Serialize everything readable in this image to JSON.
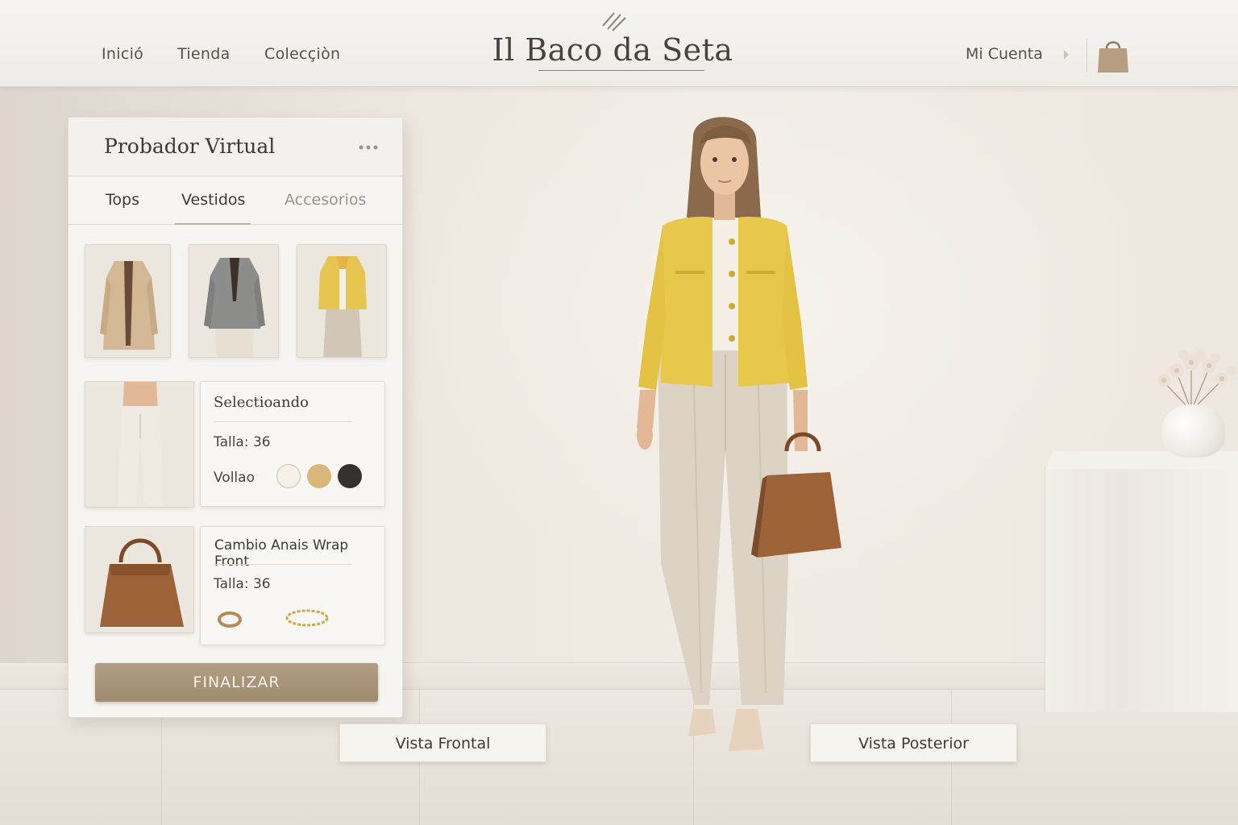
{
  "header": {
    "nav": [
      "Inició",
      "Tienda",
      "Colecçiòn"
    ],
    "brand": "Il Baco da Seta",
    "account": "Mi Cuenta"
  },
  "panel": {
    "title": "Probador Virtual",
    "tabs": [
      "Tops",
      "Vestidos",
      "Accesorios"
    ],
    "active_tab": "Vestidos",
    "selected_card": {
      "title": "Selectioando",
      "size": "Talla: 36",
      "color_label": "Vollao",
      "swatches": [
        "#f5f0e8",
        "#d9b77a",
        "#333231"
      ]
    },
    "accessory_card": {
      "title": "Cambio Anais Wrap Front",
      "size": "Talla: 36"
    },
    "finalize": "FINALIZAR"
  },
  "views": {
    "front": "Vista Frontal",
    "back": "Vista Posterior"
  },
  "colors": {
    "accent": "#a8937a",
    "jacket": "#e8c84a",
    "bag": "#9c6238"
  }
}
